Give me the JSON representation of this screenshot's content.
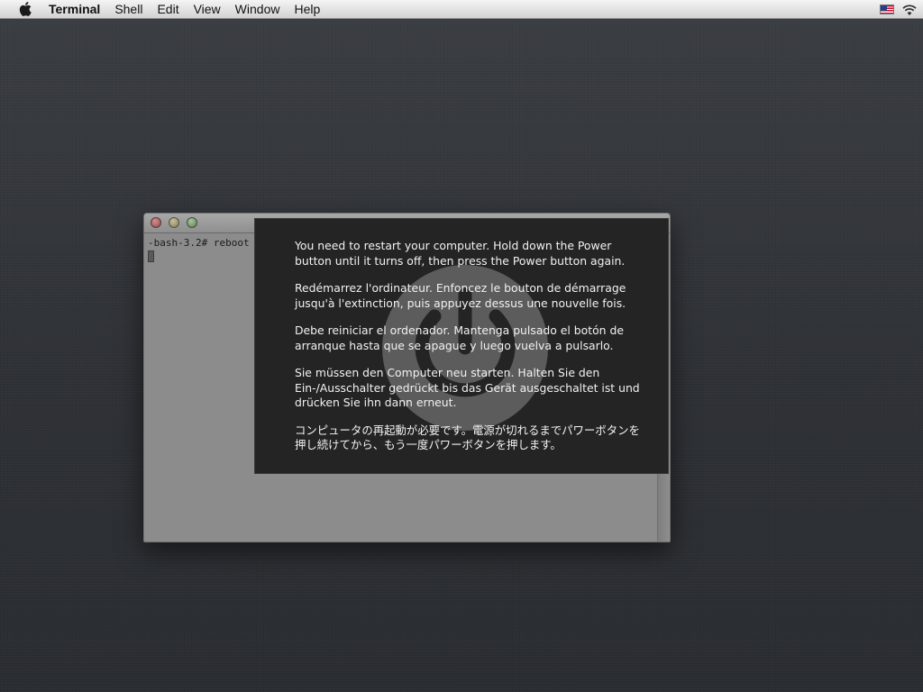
{
  "menubar": {
    "app_name": "Terminal",
    "items": [
      "Shell",
      "Edit",
      "View",
      "Window",
      "Help"
    ],
    "input_source": "us-flag-icon",
    "status_icon": "wifi-icon"
  },
  "terminal": {
    "prompt": "-bash-3.2# reboot"
  },
  "panic": {
    "messages": [
      "You need to restart your computer. Hold down the Power button until it turns off, then press the Power button again.",
      "Redémarrez l'ordinateur. Enfoncez le bouton de démarrage jusqu'à l'extinction, puis appuyez dessus une nouvelle fois.",
      "Debe reiniciar el ordenador. Mantenga pulsado el botón de arranque hasta que se apague y luego vuelva a pulsarlo.",
      "Sie müssen den Computer neu starten. Halten Sie den Ein-/Ausschalter gedrückt bis das Gerät ausgeschaltet ist und drücken Sie ihn dann erneut.",
      "コンピュータの再起動が必要です。電源が切れるまでパワーボタンを押し続けてから、もう一度パワーボタンを押します。"
    ],
    "icon": "power-icon",
    "background": "#242424",
    "text_color": "#f2f2f2"
  }
}
